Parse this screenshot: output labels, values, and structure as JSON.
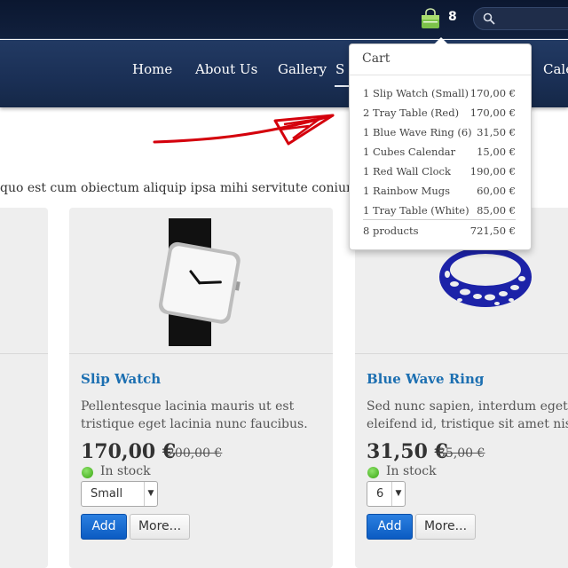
{
  "header": {
    "cart_count": "8",
    "search_placeholder": ""
  },
  "nav": {
    "items": [
      "Home",
      "About Us",
      "Gallery",
      "S",
      "Cale"
    ]
  },
  "intro_text": "quo est cum obiectum aliquip ipsa mihi servitute coniunx",
  "products": [
    {
      "title": "Slip Watch",
      "desc_line1": "Pellentesque lacinia mauris ut est",
      "desc_line2": "tristique eget lacinia nunc faucibus.",
      "price": "170,00 €",
      "old_price": "200,00 €",
      "stock": "In stock",
      "option": "Small",
      "add_label": "Add",
      "more_label": "More..."
    },
    {
      "title": "Blue Wave Ring",
      "desc_line1": "Sed nunc sapien, interdum eget",
      "desc_line2": "eleifend id, tristique sit amet nisl n",
      "price": "31,50 €",
      "old_price": "35,00 €",
      "stock": "In stock",
      "option": "6",
      "add_label": "Add",
      "more_label": "More..."
    }
  ],
  "cart": {
    "title": "Cart",
    "items": [
      {
        "name": "1 Slip Watch (Small)",
        "price": "170,00 €"
      },
      {
        "name": "2 Tray Table (Red)",
        "price": "170,00 €"
      },
      {
        "name": "1 Blue Wave Ring (6)",
        "price": "31,50 €"
      },
      {
        "name": "1 Cubes Calendar",
        "price": "15,00 €"
      },
      {
        "name": "1 Red Wall Clock",
        "price": "190,00 €"
      },
      {
        "name": "1 Rainbow Mugs",
        "price": "60,00 €"
      },
      {
        "name": "1 Tray Table (White)",
        "price": "85,00 €"
      }
    ],
    "total_label": "8 products",
    "total_price": "721,50 €"
  },
  "colors": {
    "link": "#1c6fb1",
    "add_button": "#0b5bc2",
    "nav_bg": "#1a2f55",
    "annotation_arrow": "#d4000c"
  }
}
